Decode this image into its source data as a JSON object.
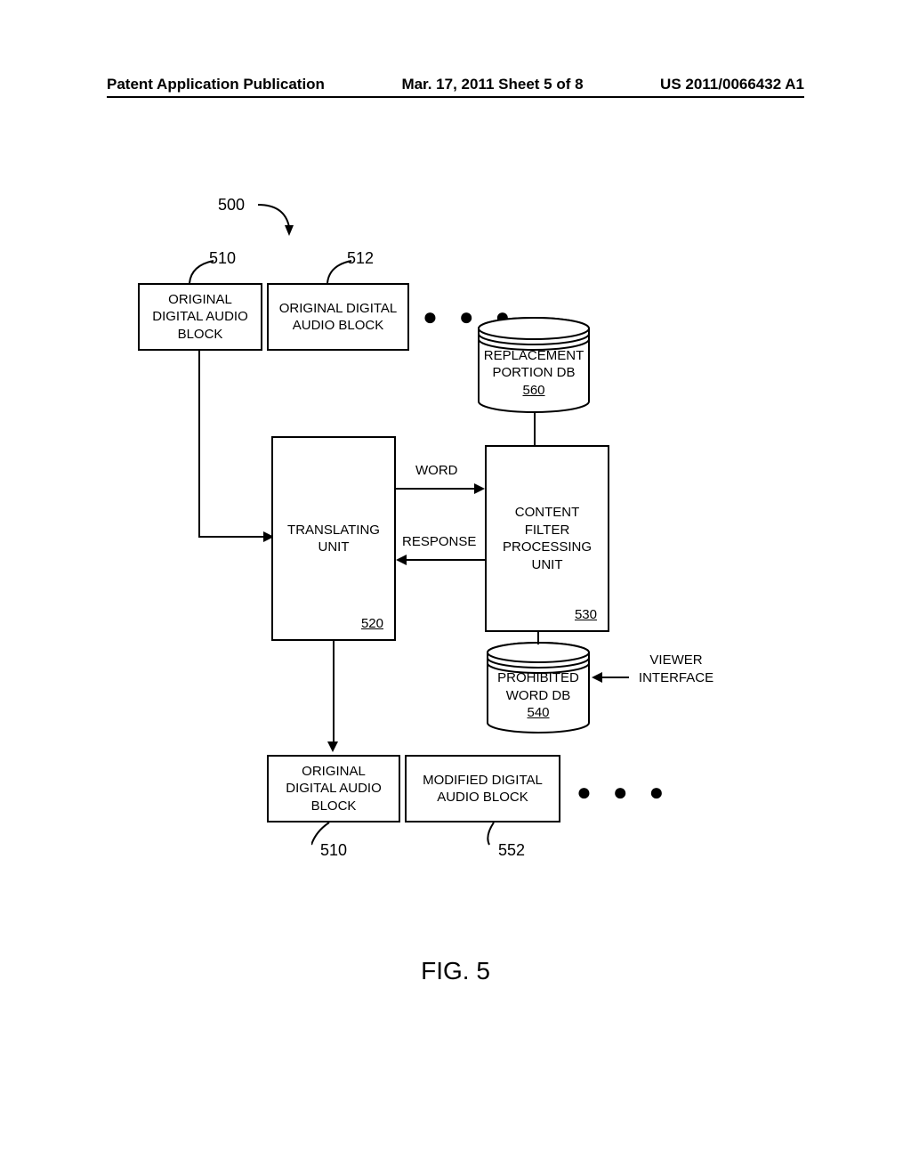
{
  "header": {
    "left": "Patent Application Publication",
    "center": "Mar. 17, 2011  Sheet 5 of 8",
    "right": "US 2011/0066432 A1"
  },
  "refs": {
    "r500": "500",
    "r510a": "510",
    "r512": "512",
    "r510b": "510",
    "r552": "552",
    "r520": "520",
    "r530": "530",
    "r540": "540",
    "r560": "560"
  },
  "labels": {
    "origBlock1": "ORIGINAL\nDIGITAL AUDIO\nBLOCK",
    "origBlock2": "ORIGINAL DIGITAL\nAUDIO BLOCK",
    "translating": "TRANSLATING\nUNIT",
    "contentFilter": "CONTENT\nFILTER\nPROCESSING\nUNIT",
    "replaceDb": "REPLACEMENT\nPORTION DB",
    "prohibitedDb": "PROHIBITED\nWORD DB",
    "viewerIf": "VIEWER\nINTERFACE",
    "word": "WORD",
    "response": "RESPONSE",
    "origBlockOut": "ORIGINAL\nDIGITAL AUDIO\nBLOCK",
    "modifiedBlock": "MODIFIED DIGITAL\nAUDIO BLOCK",
    "ellipsis": "●  ●  ●"
  },
  "figure": "FIG. 5"
}
